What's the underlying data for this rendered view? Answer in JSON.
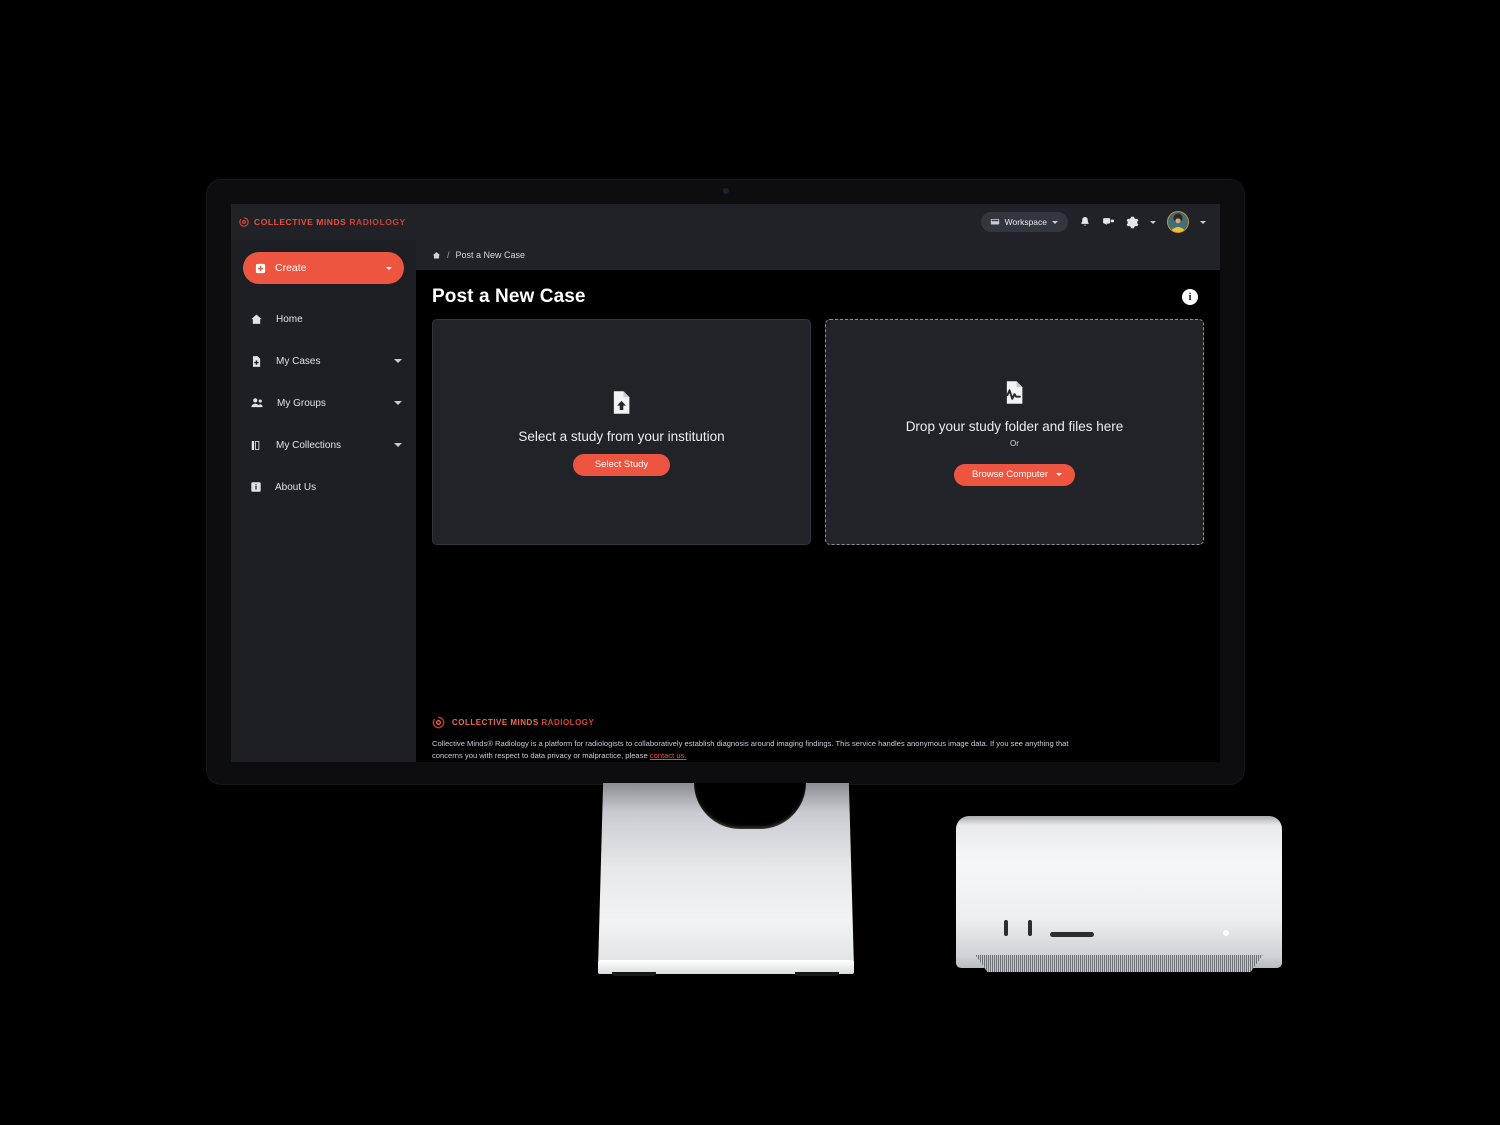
{
  "app": {
    "brand": {
      "prefix": "COLLECTIVE MINDS",
      "suffix": "RADIOLOGY",
      "icon": "collective-minds-logo-icon"
    }
  },
  "topbar": {
    "workspace": {
      "label": "Workspace",
      "icon": "workspace-icon"
    },
    "notifications_icon": "bell-icon",
    "messages_icon": "chat-icon",
    "settings_icon": "gear-icon",
    "avatar_alt": "user-avatar"
  },
  "sidebar": {
    "create": {
      "label": "Create",
      "icon": "plus-square-icon"
    },
    "items": [
      {
        "label": "Home",
        "icon": "home-icon",
        "has_caret": false
      },
      {
        "label": "My Cases",
        "icon": "case-file-icon",
        "has_caret": true
      },
      {
        "label": "My Groups",
        "icon": "people-icon",
        "has_caret": true
      },
      {
        "label": "My Collections",
        "icon": "collections-icon",
        "has_caret": true
      },
      {
        "label": "About Us",
        "icon": "info-square-icon",
        "has_caret": false
      }
    ]
  },
  "breadcrumb": {
    "home_icon": "home-icon",
    "separator": "/",
    "current": "Post a New Case"
  },
  "main": {
    "title": "Post a New Case",
    "info_badge": "i",
    "cards": [
      {
        "icon": "file-upload-icon",
        "label": "Select a study from your institution",
        "button": "Select Study",
        "button_has_caret": false,
        "or_text": null,
        "style": "solid"
      },
      {
        "icon": "file-waveform-icon",
        "label": "Drop your study folder and files here",
        "or_text": "Or",
        "button": "Browse Computer",
        "button_has_caret": true,
        "style": "dashed"
      }
    ]
  },
  "footer": {
    "brand_prefix": "COLLECTIVE MINDS",
    "brand_suffix": "RADIOLOGY",
    "brand_icon": "collective-minds-logo-icon",
    "copy_part1": "Collective Minds® Radiology is a platform for radiologists to collaboratively establish diagnosis around imaging findings. This service handles anonymous image data. If you see anything that concerns you with respect to data privacy or malpractice, please ",
    "link_text": "contact us.",
    "copy_part2": ""
  },
  "colors": {
    "accent": "#ee5540",
    "brand_red": "#e8503c",
    "topbar_bg": "#202227",
    "sidebar_bg": "#1d1f24",
    "card_bg": "#212329",
    "screen_bg": "#000000"
  },
  "hardware": {
    "display_name": "studio-display",
    "computer_name": "mac-studio"
  }
}
